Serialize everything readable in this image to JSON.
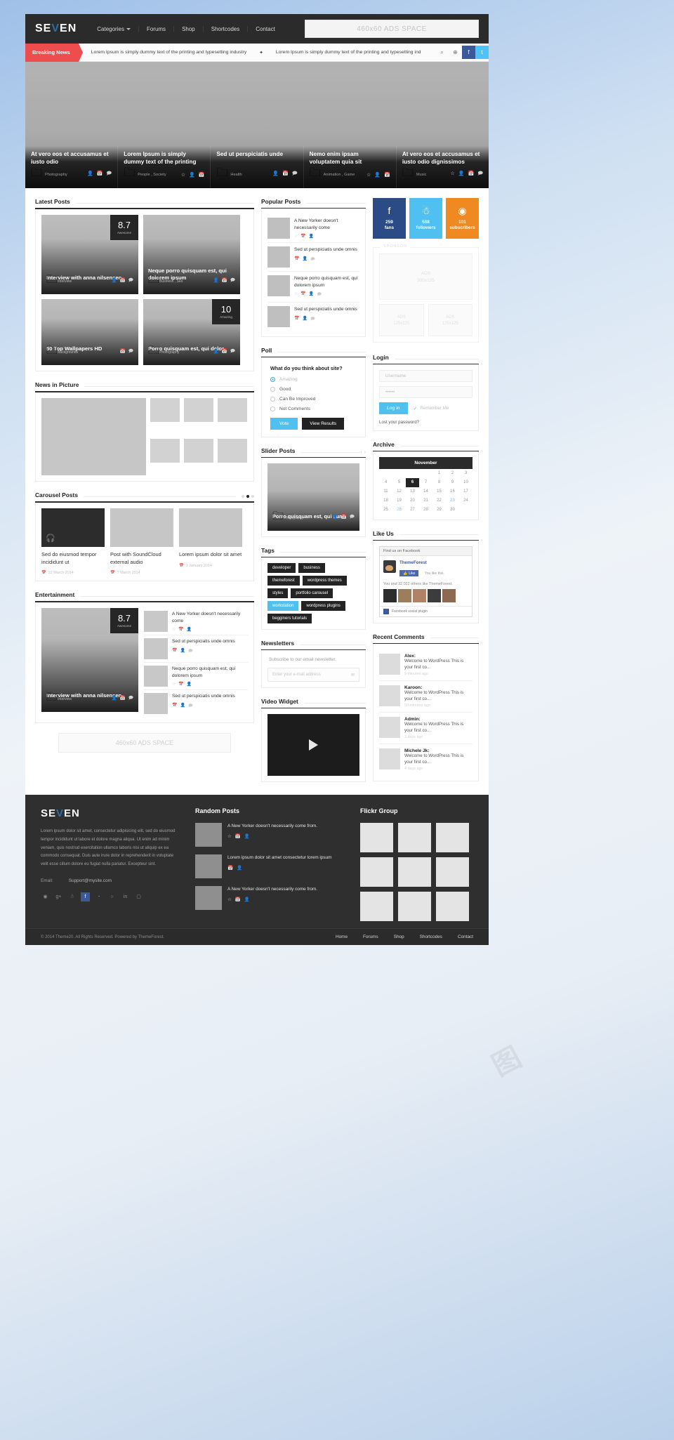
{
  "header": {
    "logo": "SEVEN",
    "nav": [
      "Categories",
      "Forums",
      "Shop",
      "Shortcodes",
      "Contact"
    ],
    "ads_label": "460x60 ADS SPACE"
  },
  "breaking": {
    "label": "Breaking News",
    "items": [
      "Lorem Ipsum is simply dummy text of the printing and typesetting industry",
      "Lorem Ipsum is simply dummy text of the printing and typesetting ind"
    ],
    "icons": [
      "search-icon",
      "globe-icon",
      "facebook-icon",
      "twitter-icon"
    ]
  },
  "featured": [
    {
      "title": "At vero eos et accusamus et iusto odio",
      "category": "Photography"
    },
    {
      "title": "Lorem Ipsum is simply dummy text of the printing",
      "category": "People , Society"
    },
    {
      "title": "Sed ut perspiciatis unde",
      "category": "Health"
    },
    {
      "title": "Nemo enim ipsam voluptatem quia sit",
      "category": "Animation , Game"
    },
    {
      "title": "At vero eos et accusamus et iusto odio dignissimos",
      "category": "Music"
    }
  ],
  "latest_posts": {
    "title": "Latest Posts",
    "cards": [
      {
        "title": "Interview with anna nilsensen",
        "category": "Interview",
        "score": "8.7",
        "score_label": "Awesome"
      },
      {
        "title": "Neque porro quisquam est, qui dolorem ipsum",
        "category": "Business , Seo",
        "score": "",
        "score_label": ""
      },
      {
        "title": "50 Top Wallpapers HD",
        "category": "Backgrounds",
        "score": "",
        "score_label": ""
      },
      {
        "title": "Porro quisquam est, qui dolor",
        "category": "Photography",
        "score": "10",
        "score_label": "Amazing"
      }
    ]
  },
  "news_in_picture": {
    "title": "News in Picture"
  },
  "carousel": {
    "title": "Carousel Posts",
    "items": [
      {
        "title": "Sed do eiusmod tempor incididunt ut",
        "date": "22 March 2014"
      },
      {
        "title": "Post with SoundCloud external audio",
        "date": "7 March 2014"
      },
      {
        "title": "Lorem ipsum dolor sit amet",
        "date": "1 January 2014"
      }
    ]
  },
  "entertainment": {
    "title": "Entertainment",
    "feature": {
      "title": "Interview with anna nilsensen",
      "category": "Interview",
      "score": "8.7",
      "score_label": "Awesome"
    },
    "list": [
      "A New Yorker doesn't necessarily come",
      "Sed ut perspiciatis unde omnis",
      "Neque porro quisquam est, qui dolorem ipsum",
      "Sed ut perspiciatis unde omnis"
    ]
  },
  "ads_wide": "460x60 ADS SPACE",
  "popular_posts": {
    "title": "Popular Posts",
    "items": [
      "A New Yorker doesn't necessarily come",
      "Sed ut perspiciatis unde omnis",
      "Neque porro quisquam est, qui dolorem ipsum",
      "Sed ut perspiciatis unde omnis"
    ]
  },
  "poll": {
    "title": "Poll",
    "question": "What do you think about site?",
    "options": [
      "Amazing",
      "Good",
      "Can Be Improved",
      "Not Comments"
    ],
    "selected": "Amazing",
    "vote_label": "Vote",
    "results_label": "View Results"
  },
  "slider_posts": {
    "title": "Slider Posts",
    "post": {
      "title": "Porro quisquam est, qui sum",
      "category": "Photography"
    }
  },
  "tags": {
    "title": "Tags",
    "items": [
      "developer",
      "business",
      "themeforest",
      "wordpress themes",
      "styles",
      "portfolio carousel",
      "workstation",
      "wordpress plugins",
      "begginers tutorials"
    ],
    "active": "workstation"
  },
  "newsletters": {
    "title": "Newsletters",
    "subtitle": "Subscribe to our email newsletter.",
    "placeholder": "Enter your e-mail address"
  },
  "video_widget": {
    "title": "Video Widget"
  },
  "social_counters": {
    "items": [
      {
        "icon": "facebook-icon",
        "glyph": "f",
        "count": "259",
        "label": "fans",
        "color": "#2b4b87"
      },
      {
        "icon": "twitter-icon",
        "glyph": "t",
        "count": "568",
        "label": "followers",
        "color": "#4fc0f0"
      },
      {
        "icon": "rss-icon",
        "glyph": "r",
        "count": "101",
        "label": "subscribers",
        "color": "#ef8a23"
      }
    ]
  },
  "sponsor": {
    "label": "SPONSOR",
    "big": {
      "line1": "ADS",
      "line2": "300x125"
    },
    "small": [
      {
        "line1": "ADS",
        "line2": "125x125"
      },
      {
        "line1": "ADS",
        "line2": "125x125"
      }
    ]
  },
  "login": {
    "title": "Login",
    "username_placeholder": "Username",
    "password_value": "••••••",
    "button": "Log in",
    "remember": "Remember Me",
    "lost": "Lost your password?"
  },
  "archive": {
    "title": "Archive",
    "month": "November",
    "weeks": [
      [
        "",
        "",
        "",
        "",
        "1",
        "2",
        "3"
      ],
      [
        "4",
        "5",
        "6",
        "7",
        "8",
        "9",
        "10"
      ],
      [
        "11",
        "12",
        "13",
        "14",
        "15",
        "16",
        "17"
      ],
      [
        "18",
        "19",
        "20",
        "21",
        "22",
        "23",
        "24"
      ],
      [
        "25",
        "26",
        "27",
        "28",
        "29",
        "30",
        ""
      ]
    ],
    "current": "6",
    "links": [
      "23",
      "26"
    ]
  },
  "like_us": {
    "title": "Like Us",
    "find_us": "Find us on Facebook",
    "page_name": "ThemeForest",
    "like_button": "Like",
    "you_like": "You like this.",
    "count_text": "You and 32,022 others like ThemeForest.",
    "footer_text": "Facebook social plugin"
  },
  "recent_comments": {
    "title": "Recent Comments",
    "items": [
      {
        "name": "Alex:",
        "body": "Welcome to WordPress This is your first co...",
        "date": "9 minutes ago"
      },
      {
        "name": "Karoon:",
        "body": "Welcome to WordPress This is your first co...",
        "date": "50 minutes ago"
      },
      {
        "name": "Admin:",
        "body": "Welcome to WordPress This is your first co...",
        "date": "3 days ago"
      },
      {
        "name": "Michele Jk:",
        "body": "Welcome to WordPress This is your first co...",
        "date": "4 days ago"
      }
    ]
  },
  "footer": {
    "logo": "SEVEN",
    "about": "Lorem ipsum dolor sit amet, consectetur adipisicing elit, sed do eiusmod tempor incididunt ut labore et dolore magna aliqua. Ut enim ad minim veniam, quis nostrud exercitation ullamco laboris nisi ut aliquip ex ea commodo consequat. Duis aute irure dolor in reprehenderit in voluptate velit esse cillum dolore eu fugiat nulla pariatur. Excepteur sint.",
    "email_label": "Email:",
    "email_value": "Support@mysite.com",
    "social": [
      "dribbble-icon",
      "google-plus-icon",
      "twitter-icon",
      "facebook-icon",
      "rss-icon",
      "github-icon",
      "linkedin-icon",
      "instagram-icon"
    ],
    "random_posts": {
      "title": "Random Posts",
      "items": [
        "A New Yorker doesn't necessarily come from.",
        "Lorem ipsum dolor sit amet consectetur lorem ipsum",
        "A New Yorker doesn't necessarily come from."
      ]
    },
    "flickr": {
      "title": "Flickr Group"
    },
    "copyright": "© 2014 Theme20. All Rights Reserved. Powered by ThemeForest.",
    "links": [
      "Home",
      "Forums",
      "Shop",
      "Shortcodes",
      "Contact"
    ]
  }
}
